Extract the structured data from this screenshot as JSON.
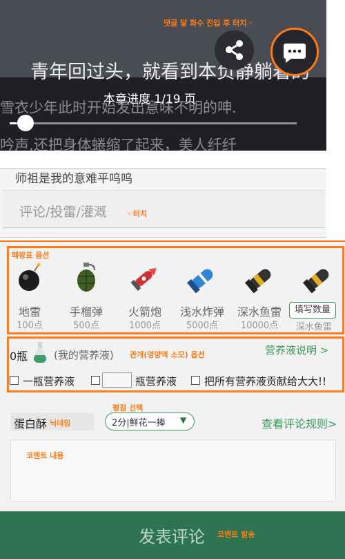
{
  "reader": {
    "text_line1": "青年回过头，就看到本负静躺着的",
    "text_line2": "雪衣少年此时开始发出意味不明的呻.",
    "text_line3": "吟声,还把身体蜷缩了起来，美人纤纤",
    "progress_label": "本章进度 1/19 页",
    "progress": 0.04,
    "annotation": "댓글 달 화수 진입 후  터치☞"
  },
  "comment_input": {
    "clipped_text": "师祖是我的意难平呜呜",
    "placeholder": "评论/投雷/灌溉",
    "annotation": "☜터치"
  },
  "bombs": {
    "annotation": "패왕표 옵션",
    "items": [
      {
        "name": "地雷",
        "price": "100点",
        "icon": "black-bomb-icon"
      },
      {
        "name": "手榴弹",
        "price": "500点",
        "icon": "grenade-icon"
      },
      {
        "name": "火箭炮",
        "price": "1000点",
        "icon": "rocket-icon"
      },
      {
        "name": "浅水炸弹",
        "price": "5000点",
        "icon": "blue-bomb-icon"
      },
      {
        "name": "深水鱼雷",
        "price": "10000点",
        "icon": "torpedo-icon"
      }
    ],
    "fill_quantity_label": "填写数量",
    "last_name": "深水鱼雷"
  },
  "nutrient": {
    "count": "0瓶",
    "mine_label": "(我的营养液)",
    "annotation": "관개(영양액 소모) 옵션",
    "explain_link": "营养液说明 >",
    "option_one": "一瓶营养液",
    "option_custom_suffix": "瓶营养液",
    "option_all": "把所有营养液贡献给大大!!"
  },
  "review": {
    "nickname": "蛋白酥",
    "nickname_annotation": "닉네임",
    "rating_annotation": "평점 선택",
    "rating_value": "2分|鲜花一捧",
    "rules_link": "查看评论规则>",
    "content_annotation": "코멘트 내용",
    "submit_label": "发表评论",
    "submit_annotation": "코멘트 발송"
  },
  "colors": {
    "annotation_orange": "#ff7b16",
    "submit_green": "#2f7450",
    "link_green": "#3a9a5a"
  }
}
